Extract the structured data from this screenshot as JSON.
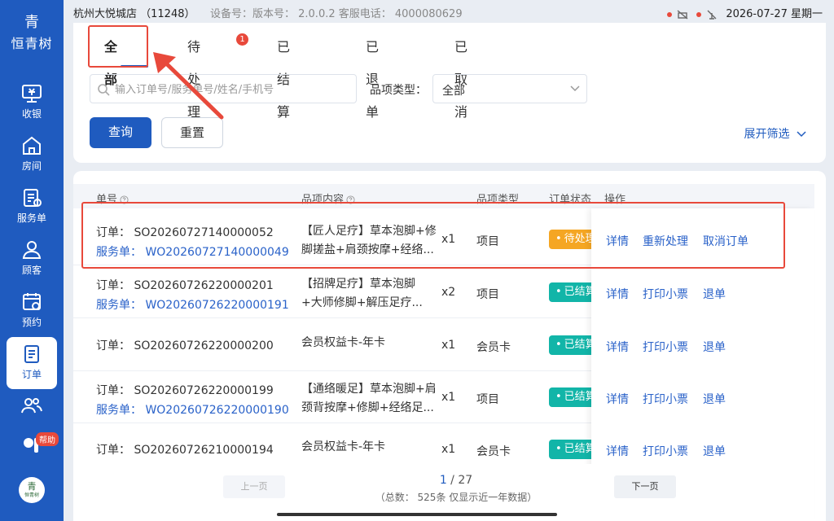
{
  "status_bar": {
    "store": "杭州大悦城店 （11248）",
    "meta": "设备号：版本号： 2.0.0.2 客服电话： 4000080629",
    "datetime": "2026-07-27 星期一"
  },
  "sidebar": {
    "logo_mark": "青",
    "logo_text": "恒青树",
    "items": [
      {
        "label": "收银",
        "icon": "cashier-icon"
      },
      {
        "label": "房间",
        "icon": "home-icon"
      },
      {
        "label": "服务单",
        "icon": "service-order-icon"
      },
      {
        "label": "顾客",
        "icon": "user-icon"
      },
      {
        "label": "预约",
        "icon": "calendar-icon"
      },
      {
        "label": "订单",
        "icon": "order-icon"
      },
      {
        "label": "",
        "icon": "staff-icon"
      }
    ],
    "help_badge": "帮助",
    "bottom_logo_mark": "青",
    "bottom_logo_text": "恒青树"
  },
  "tabs": [
    {
      "label": "全部"
    },
    {
      "label": "待处理",
      "badge": "1"
    },
    {
      "label": "已结算"
    },
    {
      "label": "已退单"
    },
    {
      "label": "已取消"
    }
  ],
  "filters": {
    "search_placeholder": "输入订单号/服务单号/姓名/手机号",
    "type_label": "品项类型：",
    "type_value": "全部",
    "query_label": "查询",
    "reset_label": "重置",
    "expand_label": "展开筛选"
  },
  "table": {
    "headers": [
      "单号",
      "品项内容",
      "品项类型",
      "订单状态",
      "操作"
    ],
    "rows": [
      {
        "order": "订单： SO20260727140000052",
        "service": "服务单： WO20260727140000049",
        "content1": "【匠人足疗】草本泡脚+修",
        "content2": "脚搓盐+肩颈按摩+经络...",
        "qty": "x1",
        "type": "项目",
        "status": "待处理",
        "ops": [
          "详情",
          "重新处理",
          "取消订单"
        ]
      },
      {
        "order": "订单： SO20260726220000201",
        "service": "服务单： WO20260726220000191",
        "content1": "【招牌足疗】草本泡脚",
        "content2": "+大师修脚+解压足疗...",
        "qty": "x2",
        "type": "项目",
        "status": "已结算",
        "ops": [
          "详情",
          "打印小票",
          "退单"
        ]
      },
      {
        "order": "订单： SO20260726220000200",
        "service": "",
        "content1": "会员权益卡-年卡",
        "content2": "",
        "qty": "x1",
        "type": "会员卡",
        "status": "已结算",
        "ops": [
          "详情",
          "打印小票",
          "退单"
        ]
      },
      {
        "order": "订单： SO20260726220000199",
        "service": "服务单： WO20260726220000190",
        "content1": "【通络暖足】草本泡脚+肩",
        "content2": "颈背按摩+修脚+经络足...",
        "qty": "x1",
        "type": "项目",
        "status": "已结算",
        "ops": [
          "详情",
          "打印小票",
          "退单"
        ]
      },
      {
        "order": "订单： SO20260726210000194",
        "service": "",
        "content1": "会员权益卡-年卡",
        "content2": "",
        "qty": "x1",
        "type": "会员卡",
        "status": "已结算",
        "ops": [
          "详情",
          "打印小票",
          "退单"
        ]
      }
    ]
  },
  "pagination": {
    "prev_label": "上一页",
    "next_label": "下一页",
    "current": "1",
    "sep": " / ",
    "total_pages": "27",
    "summary": "（总数： 525条 仅显示近一年数据）"
  },
  "colors": {
    "primary": "#1f5bbf",
    "link": "#2a62c9",
    "pending": "#f5a623",
    "settled": "#12b5a8",
    "annotation": "#e8493b"
  }
}
